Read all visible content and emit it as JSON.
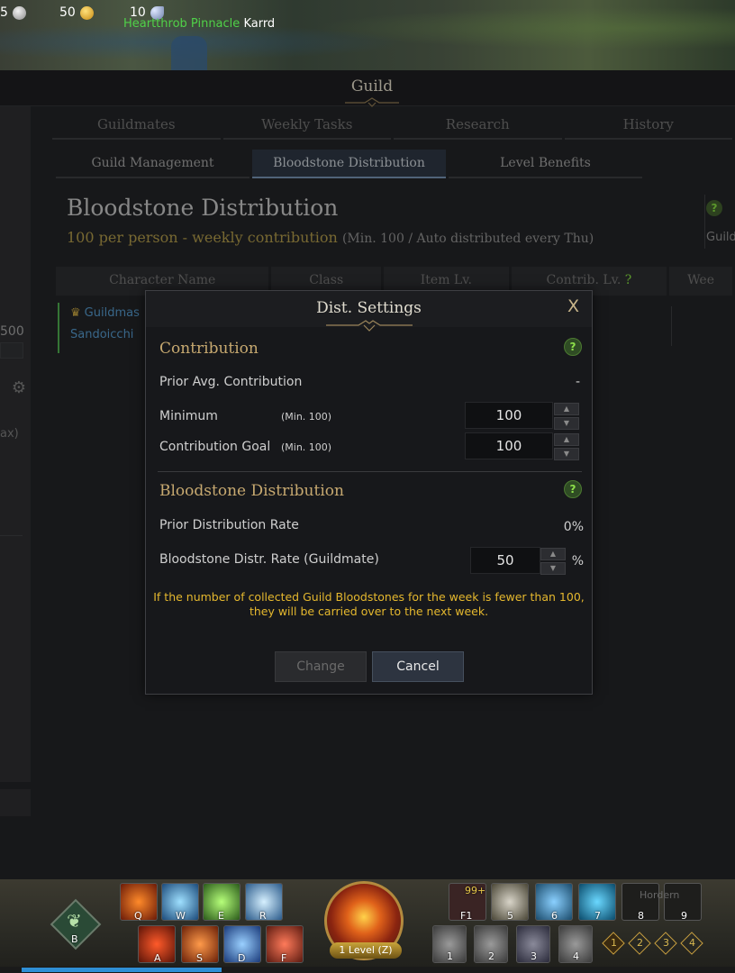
{
  "hud": {
    "silver": "5",
    "gold": "50",
    "moon": "10",
    "player_title": "Heartthrob Pinnacle",
    "player_name": "Karrd"
  },
  "guild": {
    "window_title": "Guild",
    "tabs": [
      "Guildmates",
      "Weekly Tasks",
      "Research",
      "History"
    ],
    "subtabs": [
      "Guild Management",
      "Bloodstone Distribution",
      "Level Benefits"
    ],
    "active_subtab": "Bloodstone Distribution",
    "section_title": "Bloodstone Distribution",
    "section_subtitle": "100 per person - weekly contribution",
    "section_note": "(Min. 100 / Auto distributed every Thu)",
    "right_help_text": "Guild",
    "table_headers": [
      "Character Name",
      "Class",
      "Item Lv.",
      "Contrib. Lv.",
      "Wee"
    ],
    "member": {
      "title": "Guildmas",
      "name": "Sandoicchi"
    },
    "left_value": "500",
    "left_text": "ax)"
  },
  "modal": {
    "title": "Dist. Settings",
    "close": "X",
    "contribution_section": "Contribution",
    "prior_avg_label": "Prior Avg. Contribution",
    "prior_avg_value": "-",
    "minimum_label": "Minimum",
    "minimum_min": "(Min. 100)",
    "minimum_value": "100",
    "goal_label": "Contribution Goal",
    "goal_min": "(Min. 100)",
    "goal_value": "100",
    "distribution_section": "Bloodstone Distribution",
    "prior_rate_label": "Prior Distribution Rate",
    "prior_rate_value": "0%",
    "distr_rate_label": "Bloodstone Distr. Rate (Guildmate)",
    "distr_rate_value": "50",
    "distr_rate_unit": "%",
    "warning_line1": "If the number of collected Guild Bloodstones for the week is fewer than 100,",
    "warning_line2": "they will be carried over to the next week.",
    "change_label": "Change",
    "cancel_label": "Cancel",
    "help_glyph": "?"
  },
  "hotbar": {
    "skills_top": [
      "Q",
      "W",
      "E",
      "R"
    ],
    "skills_bottom": [
      "A",
      "S",
      "D",
      "F"
    ],
    "items_top": [
      "F1",
      "5",
      "6",
      "7",
      "8",
      "9"
    ],
    "items_bottom": [
      "1",
      "2",
      "3",
      "4"
    ],
    "potion_count": "99+",
    "mount_key": "B",
    "level_button": "1 Level (Z)",
    "awakening_keys": [
      "1",
      "2",
      "3",
      "4"
    ],
    "slot9_text": "Hordern",
    "xp_fill_fraction": 0.28
  },
  "colors": {
    "accent_gold": "#c7a970",
    "warning": "#e5b82e",
    "help_green": "#8de04a",
    "member_blue": "#4f8fbf"
  }
}
